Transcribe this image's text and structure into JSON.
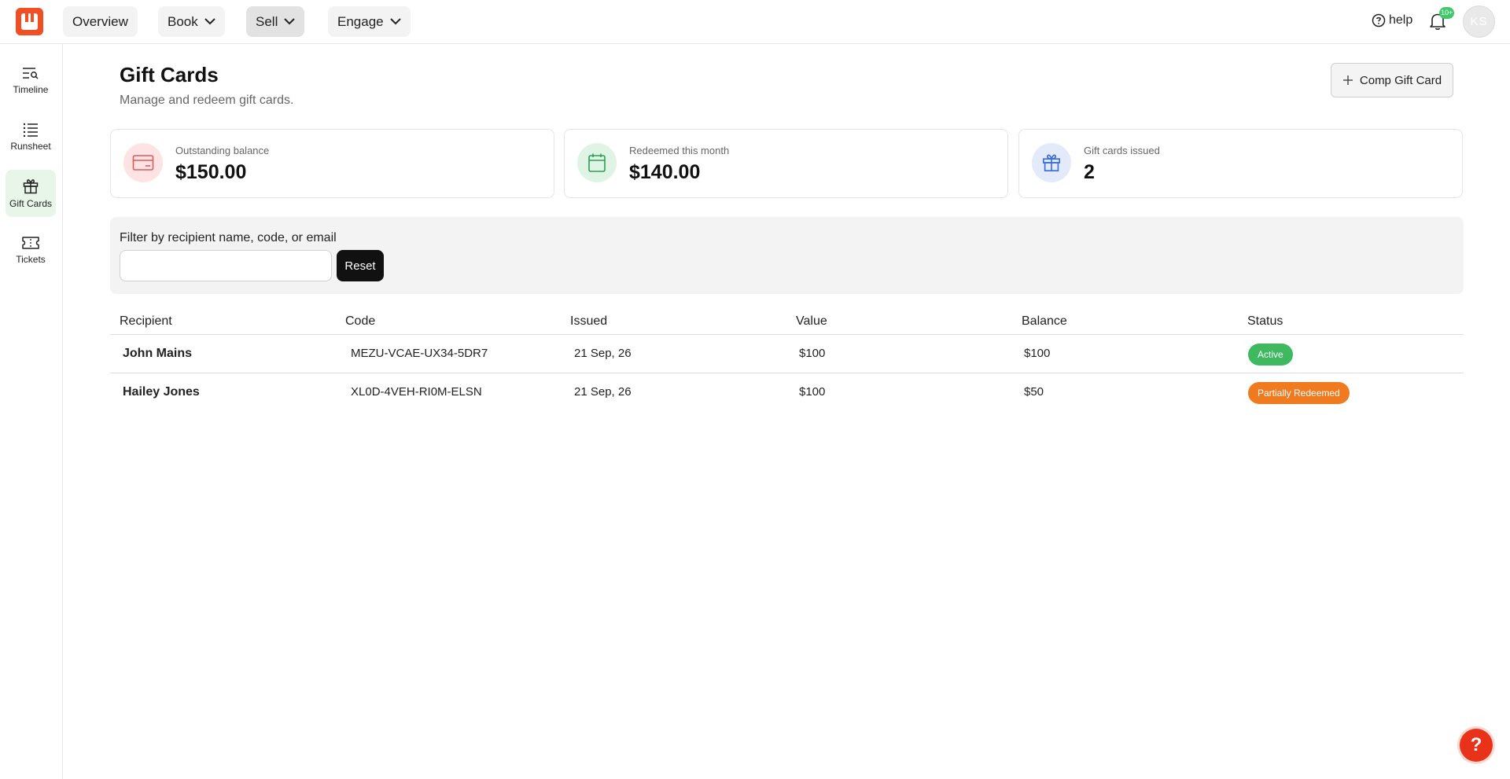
{
  "topnav": {
    "overview": "Overview",
    "book": "Book",
    "sell": "Sell",
    "engage": "Engage",
    "help": "help",
    "notif_count": "10+",
    "avatar_initials": "KS"
  },
  "sidebar": {
    "items": [
      {
        "label": "Timeline",
        "icon": "timeline-search-icon"
      },
      {
        "label": "Runsheet",
        "icon": "list-icon"
      },
      {
        "label": "Gift Cards",
        "icon": "gift-icon",
        "active": true
      },
      {
        "label": "Tickets",
        "icon": "ticket-icon"
      }
    ]
  },
  "page": {
    "title": "Gift Cards",
    "subtitle": "Manage and redeem gift cards.",
    "comp_button": "Comp Gift Card"
  },
  "stats": [
    {
      "label": "Outstanding balance",
      "value": "$150.00",
      "icon": "credit-card-icon",
      "color": "#e05a5a"
    },
    {
      "label": "Redeemed this month",
      "value": "$140.00",
      "icon": "calendar-icon",
      "color": "#2e9d55"
    },
    {
      "label": "Gift cards issued",
      "value": "2",
      "icon": "gift-icon",
      "color": "#3b6fd6"
    }
  ],
  "filter": {
    "label": "Filter by recipient name, code, or email",
    "value": "",
    "reset": "Reset"
  },
  "table": {
    "headers": [
      "Recipient",
      "Code",
      "Issued",
      "Value",
      "Balance",
      "Status"
    ],
    "rows": [
      {
        "recipient": "John Mains",
        "code": "MEZU-VCAE-UX34-5DR7",
        "issued": "21 Sep, 26",
        "value": "$100",
        "balance": "$100",
        "status": "Active",
        "status_color": "#3fb95f"
      },
      {
        "recipient": "Hailey Jones",
        "code": "XL0D-4VEH-RI0M-ELSN",
        "issued": "21 Sep, 26",
        "value": "$100",
        "balance": "$50",
        "status": "Partially Redeemed",
        "status_color": "#f07a1f"
      }
    ]
  },
  "colors": {
    "brand": "#f04e23",
    "active_nav_bg": "#e8f6ea"
  }
}
